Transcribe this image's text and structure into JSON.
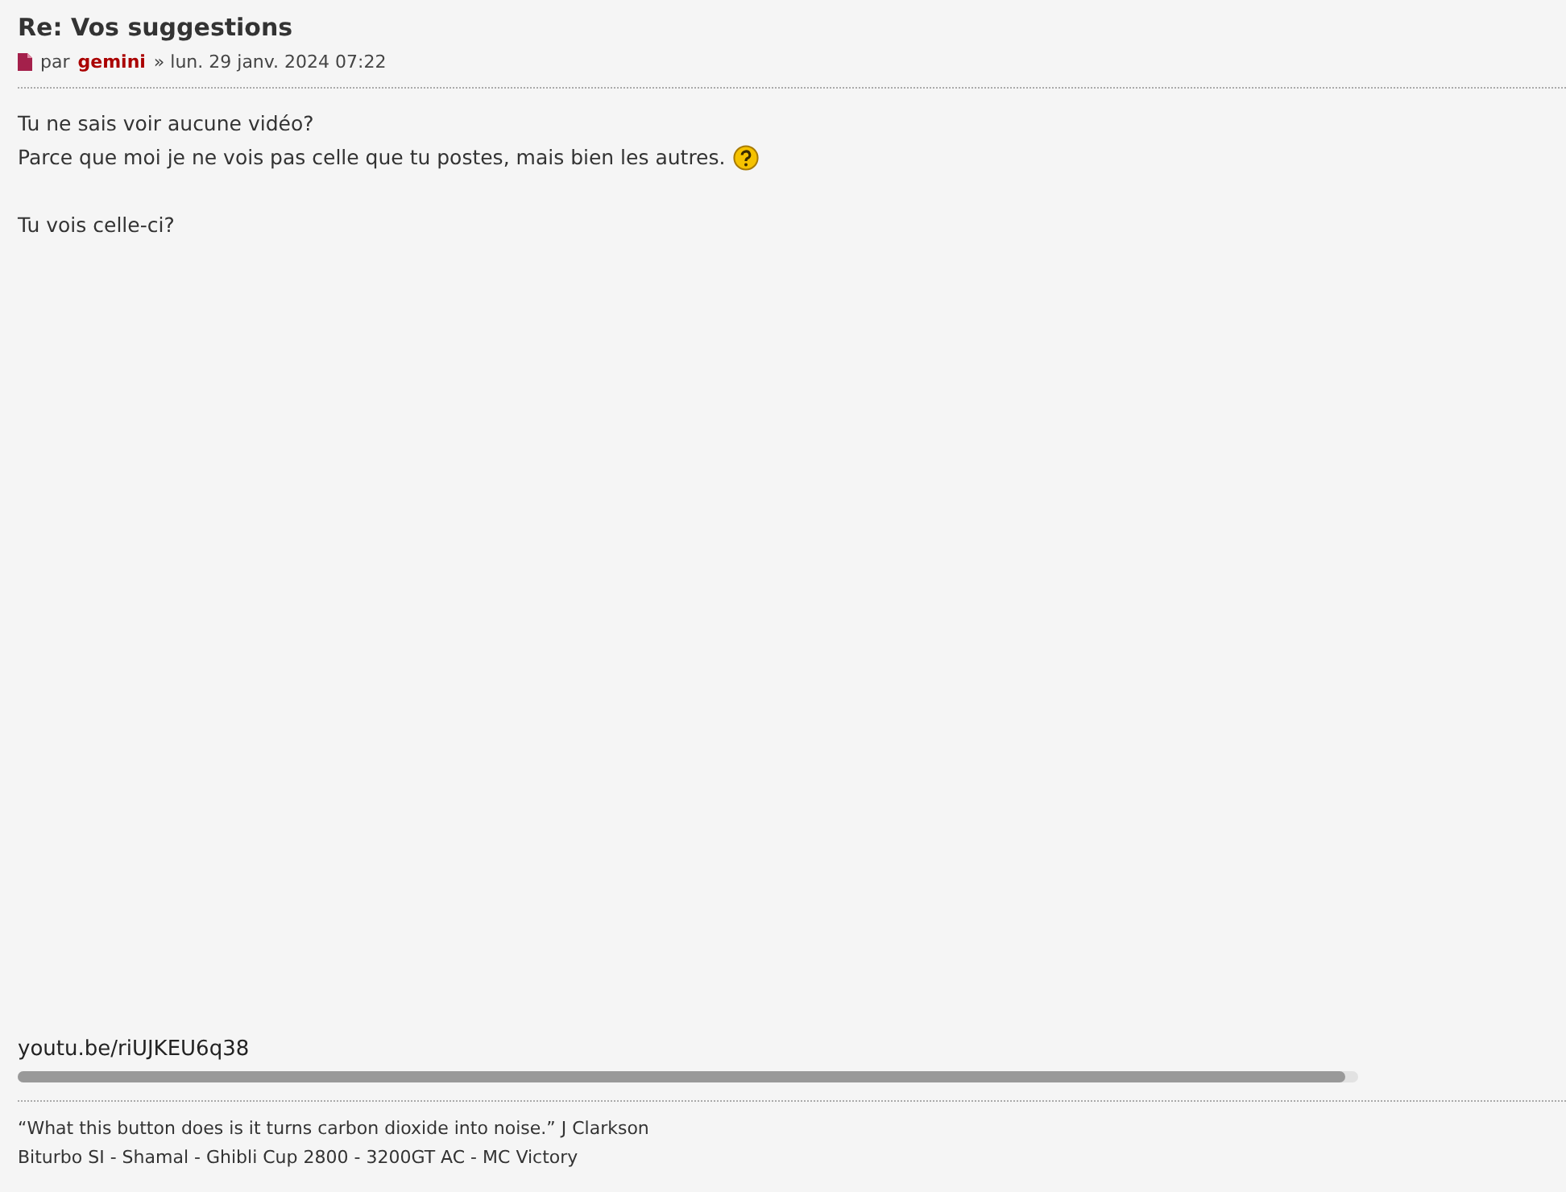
{
  "post": {
    "title": "Re: Vos suggestions",
    "meta": {
      "prefix": "par",
      "author": "gemini",
      "date": "» lun. 29 janv. 2024 07:22"
    },
    "paragraphs": [
      [
        {
          "kind": "plain",
          "text": "Tu ne sais voir aucune vidéo?"
        },
        {
          "kind": "with_smiley",
          "text": "Parce que moi je ne vois pas celle que tu postes, mais bien les autres."
        }
      ],
      [
        {
          "kind": "plain",
          "text": "Tu vois celle-ci?"
        }
      ]
    ],
    "link": "youtu.be/riUJKEU6q38"
  },
  "signature": [
    "“What this button does is it turns carbon dioxide into noise.” J Clarkson",
    "Biturbo SI - Shamal - Ghibli Cup 2800 - 3200GT AC - MC Victory"
  ]
}
